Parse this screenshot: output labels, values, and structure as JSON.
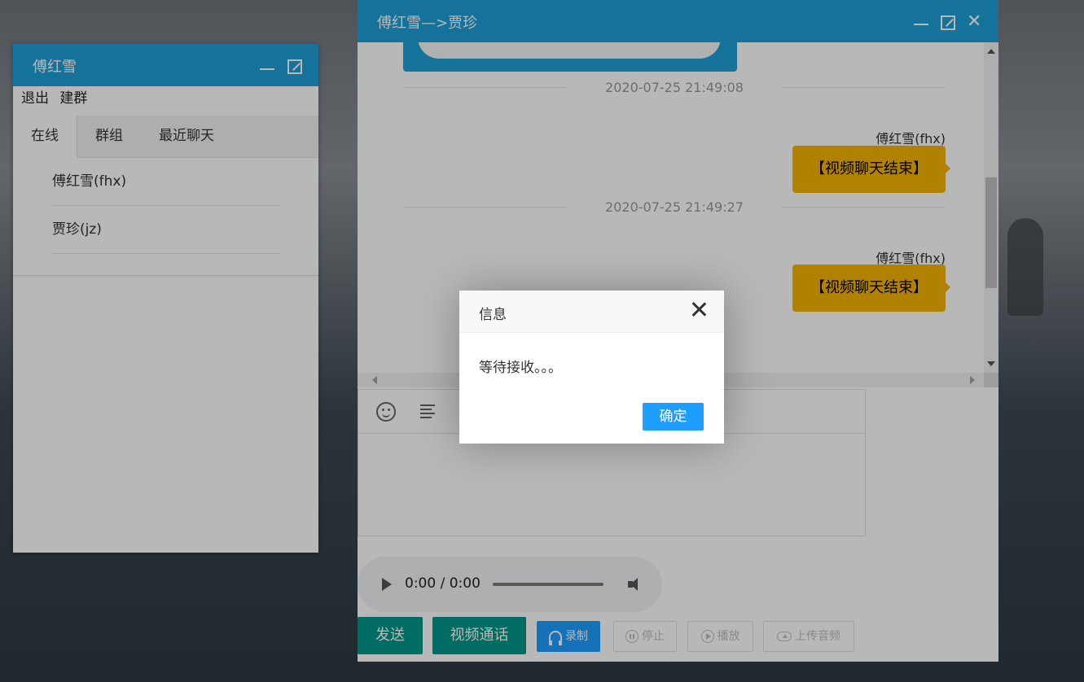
{
  "left_window": {
    "title": "傅红雪",
    "menu": [
      "退出",
      "建群"
    ],
    "tabs": [
      "在线",
      "群组",
      "最近聊天"
    ],
    "contacts": [
      "傅红雪(fhx)",
      "贾珍(jz)"
    ]
  },
  "chat_window": {
    "title": "傅红雪—>贾珍",
    "messages": [
      {
        "timestamp": "2020-07-25 21:49:08",
        "sender": "傅红雪(fhx)",
        "text": "【视频聊天结束】"
      },
      {
        "timestamp": "2020-07-25 21:49:27",
        "sender": "傅红雪(fhx)",
        "text": "【视频聊天结束】"
      }
    ],
    "audio": {
      "time": "0:00 / 0:00"
    },
    "buttons": {
      "send": "发送",
      "video_call": "视频通话",
      "record": "录制",
      "stop": "停止",
      "play": "播放",
      "upload_audio": "上传音频"
    }
  },
  "dialog": {
    "title": "信息",
    "message": "等待接收。。。",
    "ok": "确定"
  },
  "colors": {
    "title_bar": "#1e9fd7",
    "bubble": "#f5b301",
    "green_button": "#009688",
    "primary_button": "#1e9fff"
  }
}
